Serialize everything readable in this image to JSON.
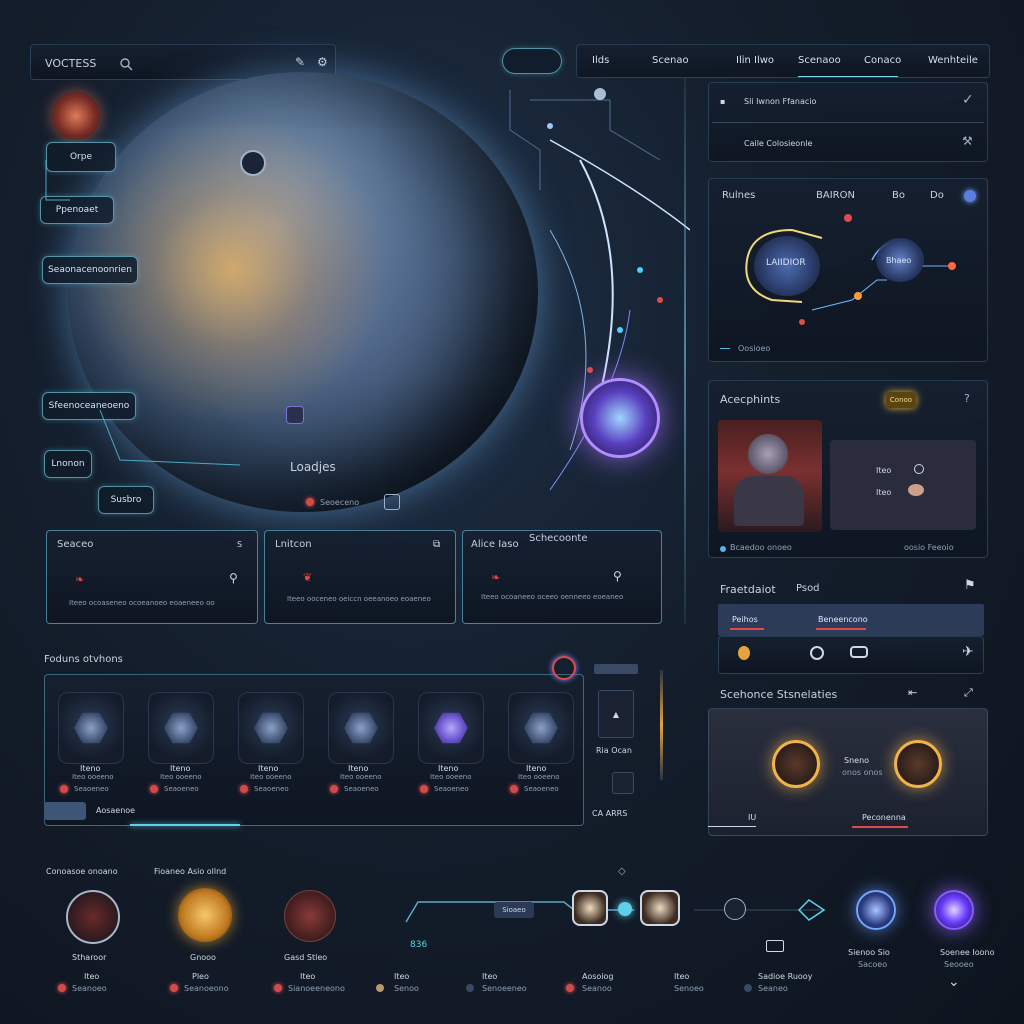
{
  "top_left": {
    "title": "VOCTESS"
  },
  "top_nav": {
    "tabs": [
      "Ilds",
      "Scenao",
      "Ilin Ilwo",
      "Scenaoo",
      "Conaco",
      "Wenhteile"
    ]
  },
  "info_rows": [
    {
      "label": "Sli Iwnon Ffanacio"
    },
    {
      "label": "Caile Colosieonle"
    }
  ],
  "left_menu": {
    "buttons": [
      "Orpe",
      "Ppenoaet",
      "Seaonacenoonrien",
      "Sfeenoceaneoeno",
      "Lnonon"
    ],
    "bottom_label": "Susbro",
    "planet_label": "Loadjes",
    "planet_sub": "Seoeceno"
  },
  "network": {
    "tabs": [
      "Rulnes",
      "BAIRON",
      "Bo",
      "Do"
    ],
    "node_left": "LAIIDIOR",
    "node_right": "Bhaeo",
    "footer": "Oosioeo"
  },
  "achievements": {
    "title": "Acecphints",
    "badge": "Conoo",
    "items": [
      {
        "label": "Iteo"
      },
      {
        "label": "Iteo"
      }
    ],
    "footer_left": "Bcaedoo onoeo",
    "footer_right": "oosio Feeoio"
  },
  "cards": [
    {
      "title": "Seaceo",
      "desc": "Iteeo ocoaseneo ocoeanoeo eoaeneeo oo",
      "badge": "S"
    },
    {
      "title": "Lnitcon",
      "desc": "Iteeo ooceneo oeiccn oeeanoeo eoaeneo",
      "badge": ""
    },
    {
      "title": "Alice Iaso",
      "title2": "Schecoonte",
      "desc": "Iteeo ocoaneeo oceeo oenneeo eoeaneo",
      "badge": ""
    }
  ],
  "features": {
    "title": "Fraetdaiot",
    "subtitle": "Psod",
    "tabs": [
      "Peihos",
      "Beneencono"
    ]
  },
  "scenarios": {
    "title": "Scehonce Stsnelaties",
    "label": "Sneno",
    "sublabel": "onos onos",
    "bottom_left": "IU",
    "bottom_tab": "Peconenna"
  },
  "inventory": {
    "title": "Foduns otvhons",
    "items": [
      {
        "name": "Iteno",
        "sub": "Iteo ooeeno",
        "tag": "Seaoeneo"
      },
      {
        "name": "Iteno",
        "sub": "Iteo ooeeno",
        "tag": "Seaoeneo"
      },
      {
        "name": "Iteno",
        "sub": "Iteo ooeeno",
        "tag": "Seaoeneo"
      },
      {
        "name": "Iteno",
        "sub": "Iteo ooeeno",
        "tag": "Seaoeneo"
      },
      {
        "name": "Iteno",
        "sub": "Iteo ooeeno",
        "tag": "Seaoeneo"
      },
      {
        "name": "Iteno",
        "sub": "Iteo ooeeno",
        "tag": "Seaoeneo"
      }
    ],
    "footer": "Aosaenoe",
    "side_label": "Ria Ocan",
    "side_footer": "CA ARRS"
  },
  "bottom": {
    "group1_title": "Conoasoe onoano",
    "group2_title": "Fioaneo Asio ollnd",
    "items": [
      {
        "title": "Stharoor",
        "name": "Iteo",
        "tag": "Seanoeo"
      },
      {
        "title": "Gnooo",
        "name": "Pleo",
        "tag": "Seanoeono"
      },
      {
        "title": "Gasd Stleo",
        "name": "Iteo",
        "tag": "Sianoeeneono"
      },
      {
        "title": "",
        "name": "Iteo",
        "tag": "Senoo"
      },
      {
        "title": "",
        "name": "Iteo",
        "tag": "Senoeeneo"
      },
      {
        "title": "",
        "name": "Aosoiog",
        "tag": "Seanoo"
      },
      {
        "title": "",
        "name": "Iteo",
        "tag": "Senoeo"
      },
      {
        "title": "",
        "name": "Sadioe Ruooy",
        "tag": "Seaneo"
      }
    ],
    "timeline_label": "Sioaeo",
    "counter": "836",
    "orb_labels": [
      "Sienoo Sio",
      "Soenee Ioono"
    ],
    "orb_subs": [
      "Sacoeo",
      "Seooeo"
    ]
  },
  "colors": {
    "accent_cyan": "#5fd0e8",
    "accent_red": "#d24b4b",
    "accent_purple": "#8a5cff",
    "accent_orange": "#e6a23c",
    "panel_bg": "#141e2c"
  }
}
